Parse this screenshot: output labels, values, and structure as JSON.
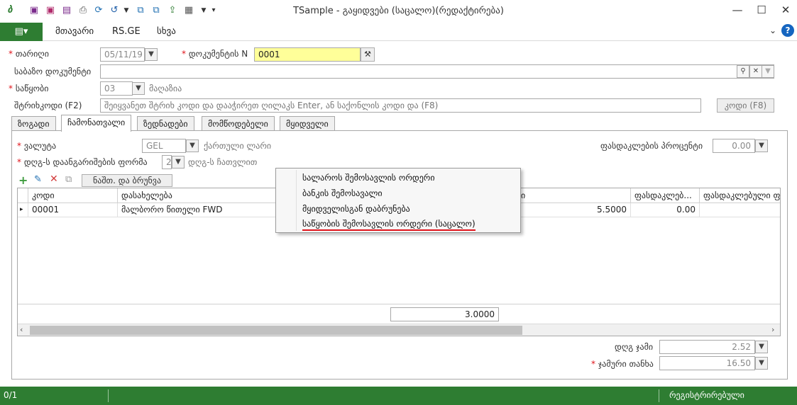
{
  "window": {
    "title": "TSample - გაყიდვები (საცალო)(რედაქტირება)",
    "quick_access": [
      "app-logo-icon",
      "save-icon",
      "save-close-icon",
      "save-as-icon",
      "print-preview-icon",
      "refresh-icon",
      "undo-icon",
      "copy-icon",
      "paste-icon",
      "export-icon",
      "layout-icon",
      "customize-icon"
    ]
  },
  "ribbon": {
    "file_glyph": "▤▾",
    "tabs": [
      "მთავარი",
      "RS.GE",
      "სხვა"
    ]
  },
  "form": {
    "date_label": "თარიღი",
    "date_value": "05/11/19",
    "docnum_label": "დოკუმენტის N",
    "docnum_value": "0001",
    "base_doc_label": "საბაზო დოკუმენტი",
    "base_doc_value": "",
    "warehouse_label": "საწყობი",
    "warehouse_value": "03",
    "warehouse_name": "მაღაზია",
    "barcode_label": "შტრიხკოდი (F2)",
    "barcode_placeholder": "შეიყვანეთ შტრიხ კოდი და დააჭირეთ ღილაკს Enter, ან საქონლის კოდი და (F8)",
    "code_button": "კოდი (F8)"
  },
  "tabs": [
    "ზოგადი",
    "ჩამონათვალი",
    "ზედნადები",
    "მომწოდებელი",
    "მყიდველი"
  ],
  "active_tab": "ჩამონათვალი",
  "panel": {
    "currency_label": "ვალუტა",
    "currency_value": "GEL",
    "currency_name": "ქართული ლარი",
    "vat_form_label": "დღგ-ს დაანგარიშების ფორმა",
    "vat_form_value": "2",
    "vat_form_name": "დღგ-ს ჩათვლით",
    "discount_pct_label": "ფასდაკლების პროცენტი",
    "discount_pct_value": "0.00",
    "remainder_button": "ნაშთ. და ბრუნვა"
  },
  "grid": {
    "columns": [
      "კოდი",
      "დასახელება",
      "ი",
      "ფასდაკლებ...",
      "ფასდაკლებული ფ"
    ],
    "rows": [
      {
        "code": "00001",
        "name": "მალბორო წითელი FWD",
        "price": "5.5000",
        "discount": "0.00",
        "discounted": ""
      }
    ],
    "total_quantity": "3.0000"
  },
  "context_menu": {
    "items": [
      "სალაროს შემოსავლის ორდერი",
      "ბანკის შემოსავალი",
      "მყიდველისგან დაბრუნება",
      "საწყობის შემოსავლის ორდერი (საცალო)"
    ],
    "highlighted_index": 3,
    "underline_color": "#e0131a"
  },
  "totals": {
    "vat_sum_label": "დღგ ჯამი",
    "vat_sum_value": "2.52",
    "total_label": "ჯამური თანხა",
    "total_value": "16.50"
  },
  "status_bar": {
    "left": "0/1",
    "right": "რეგისტრირებული"
  },
  "colors": {
    "brand_green": "#2e7d32",
    "required": "#e0131a",
    "docnum_highlight": "#ffff99"
  }
}
